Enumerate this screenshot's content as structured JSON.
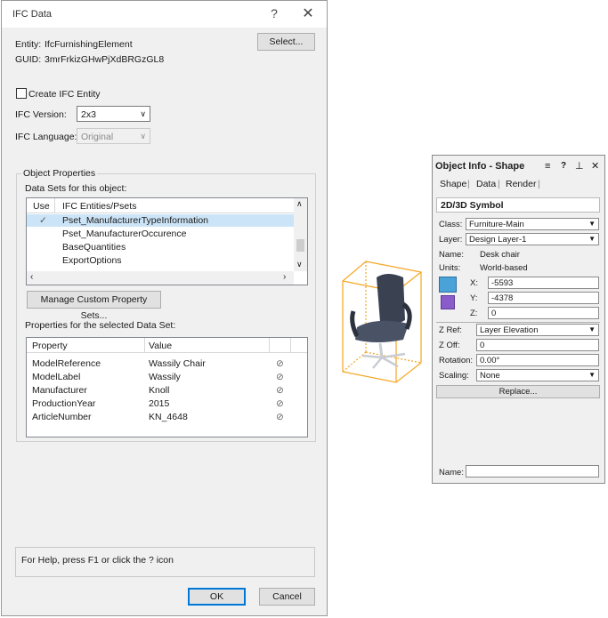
{
  "dialog": {
    "title": "IFC Data",
    "help_glyph": "?",
    "close_glyph": "✕",
    "entity_label": "Entity:",
    "entity_value": "IfcFurnishingElement",
    "guid_label": "GUID:",
    "guid_value": "3mrFrkizGHwPjXdBRGzGL8",
    "select_button": "Select...",
    "create_entity_label": "Create IFC Entity",
    "create_entity_checked": false,
    "version_label": "IFC Version:",
    "version_value": "2x3",
    "language_label": "IFC Language:",
    "language_value": "Original",
    "object_properties": {
      "group_title": "Object Properties",
      "datasets_label": "Data Sets for this object:",
      "columns": [
        "Use",
        "IFC Entities/Psets"
      ],
      "rows": [
        {
          "use": "✓",
          "name": "Pset_ManufacturerTypeInformation",
          "selected": true
        },
        {
          "use": "",
          "name": "Pset_ManufacturerOccurence",
          "selected": false
        },
        {
          "use": "",
          "name": "BaseQuantities",
          "selected": false
        },
        {
          "use": "",
          "name": "ExportOptions",
          "selected": false
        }
      ],
      "manage_button": "Manage Custom Property Sets...",
      "props_label": "Properties for the selected Data Set:",
      "prop_columns": [
        "Property",
        "Value"
      ],
      "props": [
        {
          "property": "ModelReference",
          "value": "Wassily Chair"
        },
        {
          "property": "ModelLabel",
          "value": "Wassily"
        },
        {
          "property": "Manufacturer",
          "value": "Knoll"
        },
        {
          "property": "ProductionYear",
          "value": "2015"
        },
        {
          "property": "ArticleNumber",
          "value": "KN_4648"
        }
      ]
    },
    "help_text": "For Help, press F1 or click the ? icon",
    "ok_button": "OK",
    "cancel_button": "Cancel"
  },
  "object_info": {
    "title": "Object Info - Shape",
    "tabs": [
      "Shape",
      "Data",
      "Render"
    ],
    "active_tab": "Shape",
    "section_title": "2D/3D Symbol",
    "class_label": "Class:",
    "class_value": "Furniture-Main",
    "layer_label": "Layer:",
    "layer_value": "Design Layer-1",
    "name_label": "Name:",
    "name_value": "Desk chair",
    "units_label": "Units:",
    "units_value": "World-based",
    "x_label": "X:",
    "x_value": "-5593",
    "y_label": "Y:",
    "y_value": "-4378",
    "z_label": "Z:",
    "z_value": "0",
    "zref_label": "Z Ref:",
    "zref_value": "Layer Elevation",
    "zoff_label": "Z Off:",
    "zoff_value": "0",
    "rotation_label": "Rotation:",
    "rotation_value": "0.00°",
    "scaling_label": "Scaling:",
    "scaling_value": "None",
    "replace_button": "Replace...",
    "bottom_name_label": "Name:",
    "bottom_name_value": ""
  },
  "colors": {
    "selection": "#cce4f7",
    "default_button_border": "#0078d7",
    "bounding_box": "#f5a623",
    "chair": "#3a4252"
  }
}
